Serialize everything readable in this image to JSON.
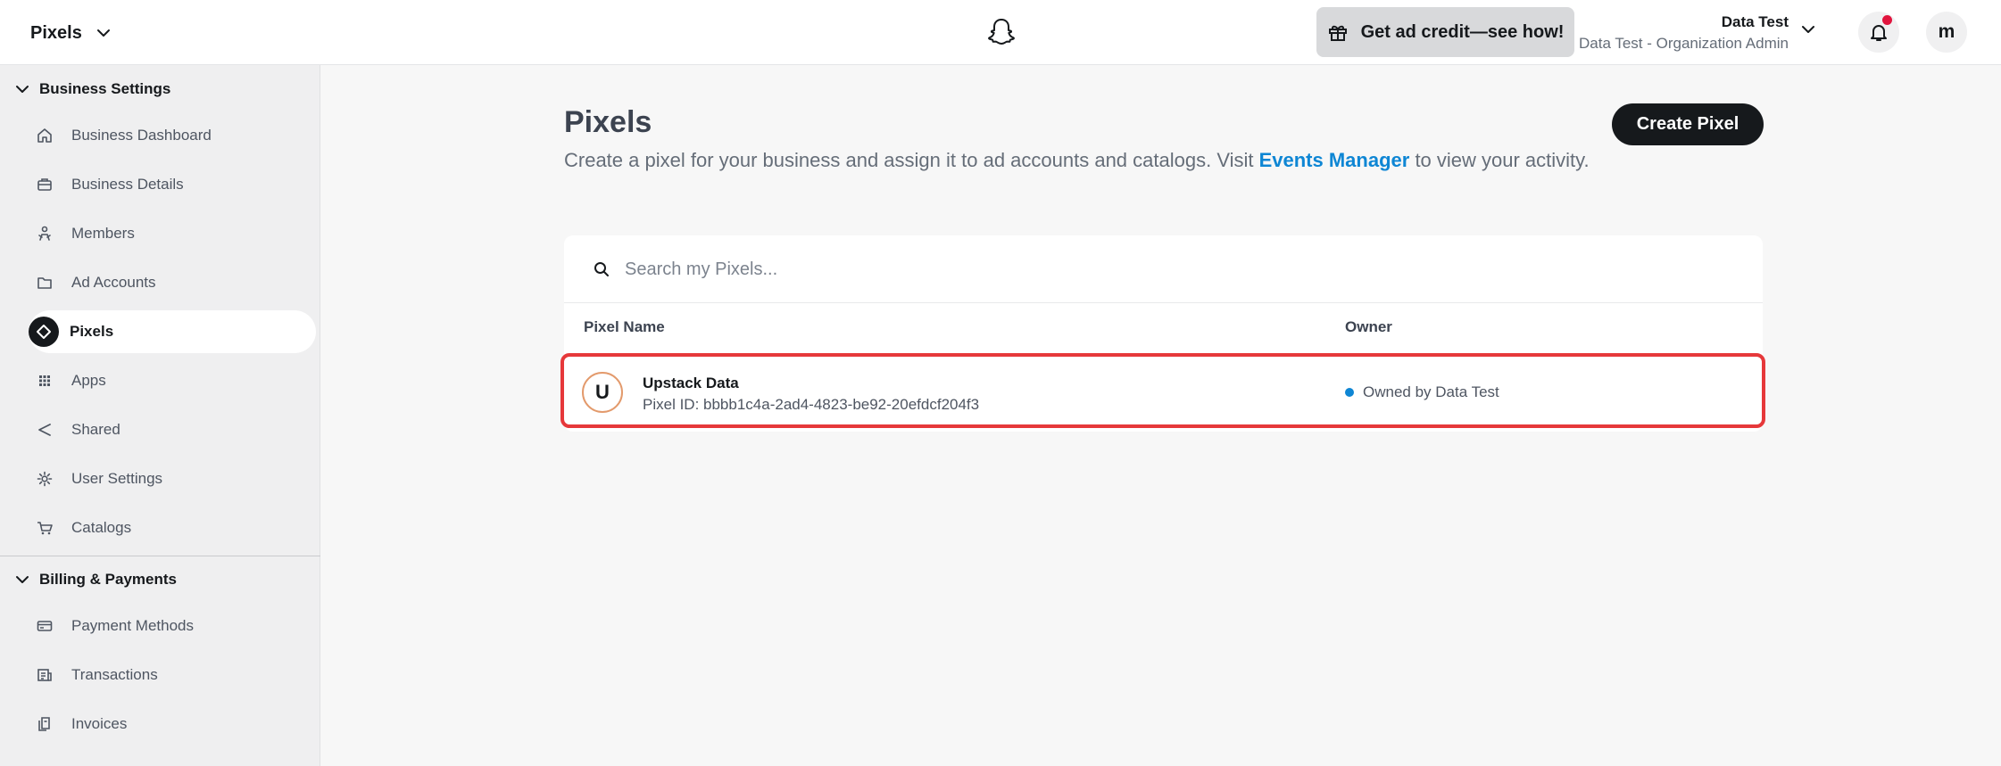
{
  "header": {
    "app_switcher_label": "Pixels",
    "promo_label": "Get ad credit—see how!",
    "org_name": "Data Test",
    "org_role": "Data Test - Organization Admin",
    "avatar_initial": "m"
  },
  "sidebar": {
    "business_settings": {
      "title": "Business Settings",
      "items": [
        {
          "label": "Business Dashboard",
          "icon": "home-icon"
        },
        {
          "label": "Business Details",
          "icon": "briefcase-icon"
        },
        {
          "label": "Members",
          "icon": "members-icon"
        },
        {
          "label": "Ad Accounts",
          "icon": "folder-icon"
        },
        {
          "label": "Pixels",
          "icon": "pixel-icon",
          "active": true
        },
        {
          "label": "Apps",
          "icon": "grid-icon"
        },
        {
          "label": "Shared",
          "icon": "share-icon"
        },
        {
          "label": "User Settings",
          "icon": "gear-icon"
        },
        {
          "label": "Catalogs",
          "icon": "cart-icon"
        }
      ]
    },
    "billing_payments": {
      "title": "Billing & Payments",
      "items": [
        {
          "label": "Payment Methods",
          "icon": "credit-card-icon"
        },
        {
          "label": "Transactions",
          "icon": "receipt-icon"
        },
        {
          "label": "Invoices",
          "icon": "invoice-icon"
        }
      ]
    }
  },
  "main": {
    "title": "Pixels",
    "description_before": "Create a pixel for your business and assign it to ad accounts and catalogs. Visit ",
    "description_link": "Events Manager",
    "description_after": " to view your activity.",
    "create_button": "Create Pixel",
    "search_placeholder": "Search my Pixels...",
    "table": {
      "columns": [
        "Pixel Name",
        "Owner"
      ],
      "rows": [
        {
          "avatar_initial": "U",
          "name": "Upstack Data",
          "pixel_id": "Pixel ID: bbbb1c4a-2ad4-4823-be92-20efdcf204f3",
          "owner": "Owned by Data Test"
        }
      ]
    }
  },
  "colors": {
    "accent_blue": "#0e86d4",
    "highlight_red": "#e6383a",
    "notification_dot": "#e1143d",
    "primary_dark": "#16191c"
  }
}
